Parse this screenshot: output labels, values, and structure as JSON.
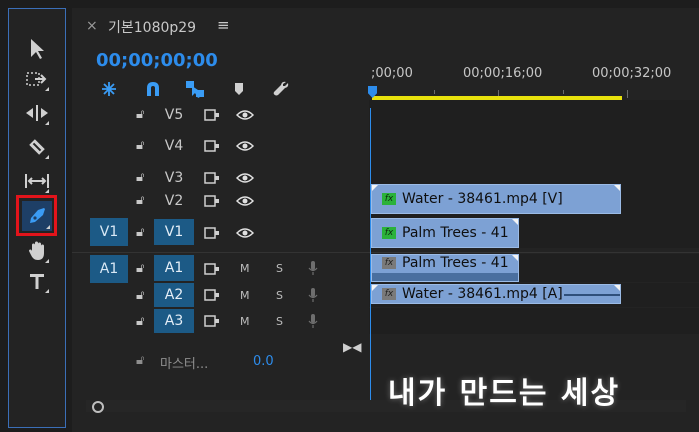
{
  "tab": {
    "close": "×",
    "title": "기본1080p29",
    "menu": "≡"
  },
  "timecode": "00;00;00;00",
  "ruler": {
    "labels": [
      ";00;00",
      "00;00;16;00",
      "00;00;32;00"
    ]
  },
  "tools": [
    "selection-tool",
    "track-select-forward-tool",
    "ripple-edit-tool",
    "razor-tool",
    "slip-tool",
    "pen-tool",
    "hand-tool",
    "type-tool"
  ],
  "selected_tool": "pen-tool",
  "tracks": {
    "v5": {
      "name": "V5"
    },
    "v4": {
      "name": "V4"
    },
    "v3": {
      "name": "V3"
    },
    "v2": {
      "name": "V2"
    },
    "v1": {
      "source": "V1",
      "name": "V1"
    },
    "a1": {
      "source": "A1",
      "name": "A1",
      "mute": "M",
      "solo": "S"
    },
    "a2": {
      "name": "A2",
      "mute": "M",
      "solo": "S"
    },
    "a3": {
      "name": "A3",
      "mute": "M",
      "solo": "S"
    }
  },
  "clips": {
    "v2": {
      "fx": "fx",
      "label": "Water - 38461.mp4 [V]"
    },
    "v1": {
      "fx": "fx",
      "label": "Palm Trees - 41"
    },
    "a1": {
      "fx": "fx",
      "label": "Palm Trees - 41"
    },
    "a2": {
      "fx": "fx",
      "label": "Water - 38461.mp4 [A]"
    }
  },
  "master": {
    "label": "마스터...",
    "value": "0.0"
  },
  "watermark": "내가 만드는 세상",
  "colors": {
    "accent": "#2d8ceb",
    "clip": "#7da1d4",
    "work_area": "#e8e10c",
    "highlight": "#e2141b",
    "track_target": "#1c5a86"
  }
}
